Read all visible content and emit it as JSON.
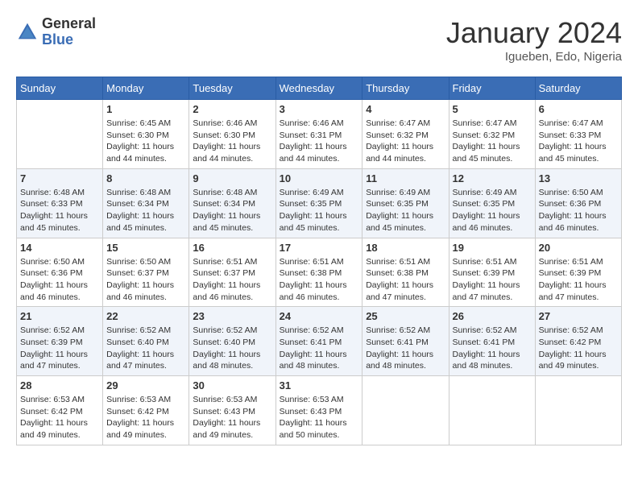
{
  "logo": {
    "text_general": "General",
    "text_blue": "Blue"
  },
  "title": "January 2024",
  "location": "Igueben, Edo, Nigeria",
  "days_of_week": [
    "Sunday",
    "Monday",
    "Tuesday",
    "Wednesday",
    "Thursday",
    "Friday",
    "Saturday"
  ],
  "weeks": [
    [
      {
        "day": "",
        "sunrise": "",
        "sunset": "",
        "daylight": ""
      },
      {
        "day": "1",
        "sunrise": "Sunrise: 6:45 AM",
        "sunset": "Sunset: 6:30 PM",
        "daylight": "Daylight: 11 hours and 44 minutes."
      },
      {
        "day": "2",
        "sunrise": "Sunrise: 6:46 AM",
        "sunset": "Sunset: 6:30 PM",
        "daylight": "Daylight: 11 hours and 44 minutes."
      },
      {
        "day": "3",
        "sunrise": "Sunrise: 6:46 AM",
        "sunset": "Sunset: 6:31 PM",
        "daylight": "Daylight: 11 hours and 44 minutes."
      },
      {
        "day": "4",
        "sunrise": "Sunrise: 6:47 AM",
        "sunset": "Sunset: 6:32 PM",
        "daylight": "Daylight: 11 hours and 44 minutes."
      },
      {
        "day": "5",
        "sunrise": "Sunrise: 6:47 AM",
        "sunset": "Sunset: 6:32 PM",
        "daylight": "Daylight: 11 hours and 45 minutes."
      },
      {
        "day": "6",
        "sunrise": "Sunrise: 6:47 AM",
        "sunset": "Sunset: 6:33 PM",
        "daylight": "Daylight: 11 hours and 45 minutes."
      }
    ],
    [
      {
        "day": "7",
        "sunrise": "Sunrise: 6:48 AM",
        "sunset": "Sunset: 6:33 PM",
        "daylight": "Daylight: 11 hours and 45 minutes."
      },
      {
        "day": "8",
        "sunrise": "Sunrise: 6:48 AM",
        "sunset": "Sunset: 6:34 PM",
        "daylight": "Daylight: 11 hours and 45 minutes."
      },
      {
        "day": "9",
        "sunrise": "Sunrise: 6:48 AM",
        "sunset": "Sunset: 6:34 PM",
        "daylight": "Daylight: 11 hours and 45 minutes."
      },
      {
        "day": "10",
        "sunrise": "Sunrise: 6:49 AM",
        "sunset": "Sunset: 6:35 PM",
        "daylight": "Daylight: 11 hours and 45 minutes."
      },
      {
        "day": "11",
        "sunrise": "Sunrise: 6:49 AM",
        "sunset": "Sunset: 6:35 PM",
        "daylight": "Daylight: 11 hours and 45 minutes."
      },
      {
        "day": "12",
        "sunrise": "Sunrise: 6:49 AM",
        "sunset": "Sunset: 6:35 PM",
        "daylight": "Daylight: 11 hours and 46 minutes."
      },
      {
        "day": "13",
        "sunrise": "Sunrise: 6:50 AM",
        "sunset": "Sunset: 6:36 PM",
        "daylight": "Daylight: 11 hours and 46 minutes."
      }
    ],
    [
      {
        "day": "14",
        "sunrise": "Sunrise: 6:50 AM",
        "sunset": "Sunset: 6:36 PM",
        "daylight": "Daylight: 11 hours and 46 minutes."
      },
      {
        "day": "15",
        "sunrise": "Sunrise: 6:50 AM",
        "sunset": "Sunset: 6:37 PM",
        "daylight": "Daylight: 11 hours and 46 minutes."
      },
      {
        "day": "16",
        "sunrise": "Sunrise: 6:51 AM",
        "sunset": "Sunset: 6:37 PM",
        "daylight": "Daylight: 11 hours and 46 minutes."
      },
      {
        "day": "17",
        "sunrise": "Sunrise: 6:51 AM",
        "sunset": "Sunset: 6:38 PM",
        "daylight": "Daylight: 11 hours and 46 minutes."
      },
      {
        "day": "18",
        "sunrise": "Sunrise: 6:51 AM",
        "sunset": "Sunset: 6:38 PM",
        "daylight": "Daylight: 11 hours and 47 minutes."
      },
      {
        "day": "19",
        "sunrise": "Sunrise: 6:51 AM",
        "sunset": "Sunset: 6:39 PM",
        "daylight": "Daylight: 11 hours and 47 minutes."
      },
      {
        "day": "20",
        "sunrise": "Sunrise: 6:51 AM",
        "sunset": "Sunset: 6:39 PM",
        "daylight": "Daylight: 11 hours and 47 minutes."
      }
    ],
    [
      {
        "day": "21",
        "sunrise": "Sunrise: 6:52 AM",
        "sunset": "Sunset: 6:39 PM",
        "daylight": "Daylight: 11 hours and 47 minutes."
      },
      {
        "day": "22",
        "sunrise": "Sunrise: 6:52 AM",
        "sunset": "Sunset: 6:40 PM",
        "daylight": "Daylight: 11 hours and 47 minutes."
      },
      {
        "day": "23",
        "sunrise": "Sunrise: 6:52 AM",
        "sunset": "Sunset: 6:40 PM",
        "daylight": "Daylight: 11 hours and 48 minutes."
      },
      {
        "day": "24",
        "sunrise": "Sunrise: 6:52 AM",
        "sunset": "Sunset: 6:41 PM",
        "daylight": "Daylight: 11 hours and 48 minutes."
      },
      {
        "day": "25",
        "sunrise": "Sunrise: 6:52 AM",
        "sunset": "Sunset: 6:41 PM",
        "daylight": "Daylight: 11 hours and 48 minutes."
      },
      {
        "day": "26",
        "sunrise": "Sunrise: 6:52 AM",
        "sunset": "Sunset: 6:41 PM",
        "daylight": "Daylight: 11 hours and 48 minutes."
      },
      {
        "day": "27",
        "sunrise": "Sunrise: 6:52 AM",
        "sunset": "Sunset: 6:42 PM",
        "daylight": "Daylight: 11 hours and 49 minutes."
      }
    ],
    [
      {
        "day": "28",
        "sunrise": "Sunrise: 6:53 AM",
        "sunset": "Sunset: 6:42 PM",
        "daylight": "Daylight: 11 hours and 49 minutes."
      },
      {
        "day": "29",
        "sunrise": "Sunrise: 6:53 AM",
        "sunset": "Sunset: 6:42 PM",
        "daylight": "Daylight: 11 hours and 49 minutes."
      },
      {
        "day": "30",
        "sunrise": "Sunrise: 6:53 AM",
        "sunset": "Sunset: 6:43 PM",
        "daylight": "Daylight: 11 hours and 49 minutes."
      },
      {
        "day": "31",
        "sunrise": "Sunrise: 6:53 AM",
        "sunset": "Sunset: 6:43 PM",
        "daylight": "Daylight: 11 hours and 50 minutes."
      },
      {
        "day": "",
        "sunrise": "",
        "sunset": "",
        "daylight": ""
      },
      {
        "day": "",
        "sunrise": "",
        "sunset": "",
        "daylight": ""
      },
      {
        "day": "",
        "sunrise": "",
        "sunset": "",
        "daylight": ""
      }
    ]
  ]
}
